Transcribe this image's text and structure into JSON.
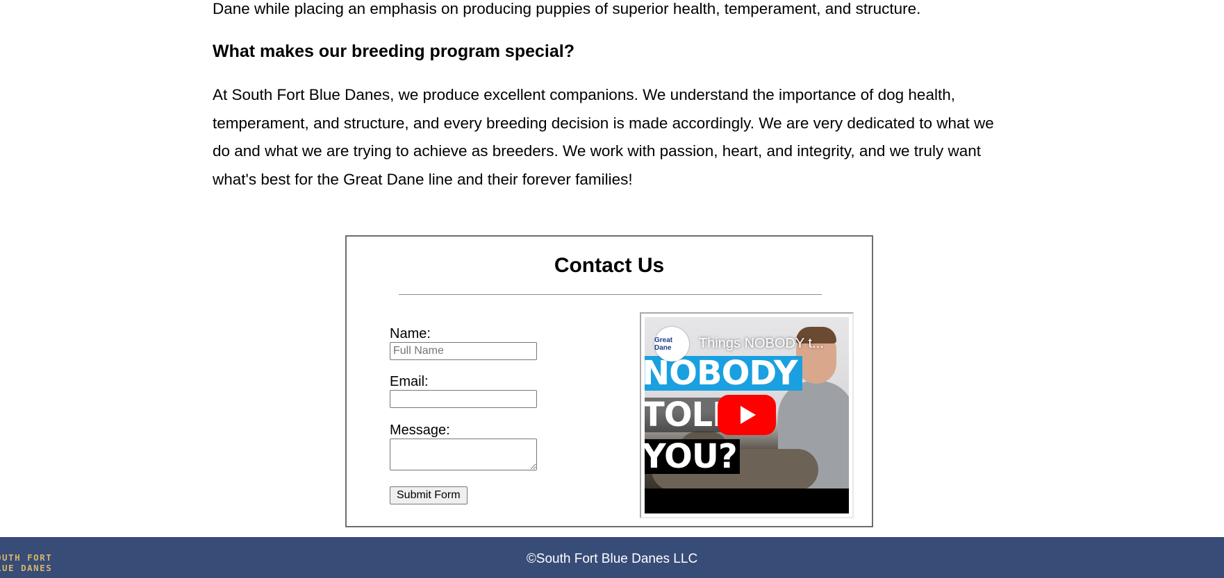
{
  "intro": {
    "line": "Dane while placing an emphasis on producing puppies of superior health, temperament, and structure."
  },
  "section": {
    "heading": "What makes our breeding program special?",
    "body": "At South Fort Blue Danes, we produce excellent companions. We understand the importance of dog health, temperament, and structure, and every breeding decision is made accordingly. We are very dedicated to what we do and what we are trying to achieve as breeders. We work with passion, heart, and integrity, and we truly want what's best for the Great Dane line and their forever families!"
  },
  "contact": {
    "title": "Contact Us",
    "name_label": "Name:",
    "name_placeholder": "Full Name",
    "name_value": "",
    "email_label": "Email:",
    "email_value": "",
    "message_label": "Message:",
    "message_value": "",
    "submit_label": "Submit Form"
  },
  "video": {
    "title": "Things NOBODY t...",
    "channel_logo_text": "Great Dane",
    "thumbnail_words": [
      "NOBODY",
      "TOLD",
      "YOU?"
    ],
    "play_icon": "play-icon",
    "play_color": "#ff0000"
  },
  "footer": {
    "logo_line1": "OUTH FORT",
    "logo_line2": "LUE DANES",
    "copyright": "©South Fort Blue Danes LLC",
    "background": "#374c77",
    "logo_color": "#d8b56a"
  }
}
